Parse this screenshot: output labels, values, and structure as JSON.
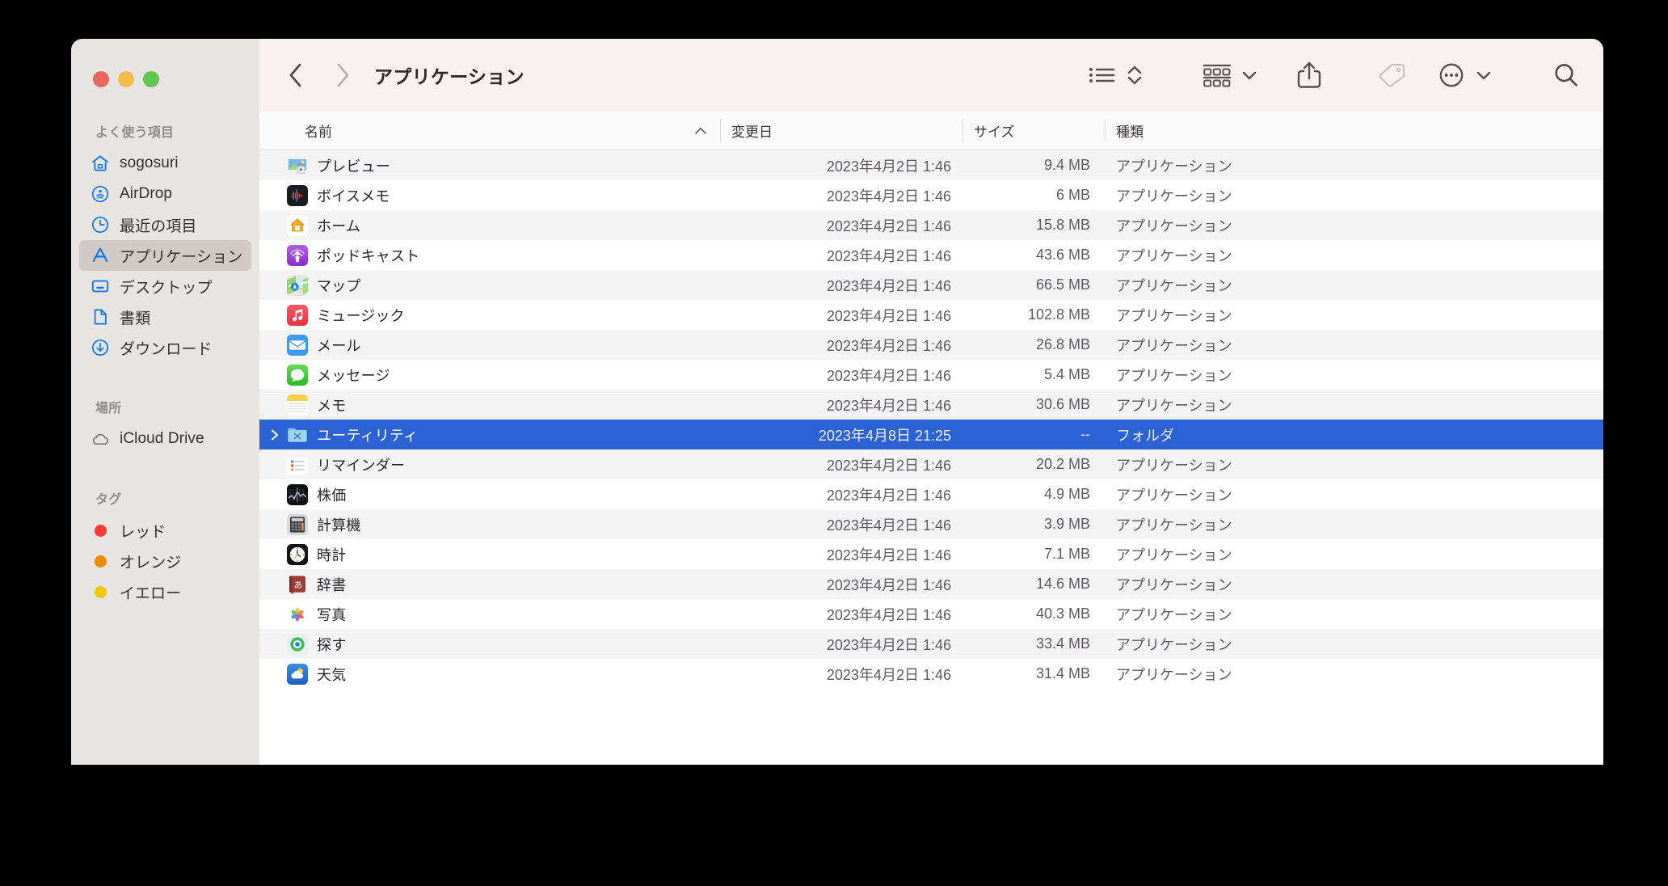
{
  "window": {
    "title": "アプリケーション",
    "traffic_lights": [
      {
        "name": "close",
        "color": "#e8685d"
      },
      {
        "name": "minimize",
        "color": "#f3bd4e"
      },
      {
        "name": "maximize",
        "color": "#61c554"
      }
    ]
  },
  "toolbar": {
    "back_label": "戻る",
    "forward_label": "進む",
    "view_list_label": "リスト表示",
    "view_arrange_label": "表示順",
    "group_label": "グループ",
    "share_label": "共有",
    "tag_label": "タグ",
    "more_label": "その他",
    "search_label": "検索"
  },
  "sidebar": {
    "sections": [
      {
        "title": "よく使う項目",
        "items": [
          {
            "label": "sogosuri",
            "icon": "home-icon",
            "selected": false
          },
          {
            "label": "AirDrop",
            "icon": "airdrop-icon",
            "selected": false
          },
          {
            "label": "最近の項目",
            "icon": "clock-icon",
            "selected": false
          },
          {
            "label": "アプリケーション",
            "icon": "applications-icon",
            "selected": true
          },
          {
            "label": "デスクトップ",
            "icon": "desktop-icon",
            "selected": false
          },
          {
            "label": "書類",
            "icon": "document-icon",
            "selected": false
          },
          {
            "label": "ダウンロード",
            "icon": "download-icon",
            "selected": false
          }
        ]
      },
      {
        "title": "場所",
        "items": [
          {
            "label": "iCloud Drive",
            "icon": "cloud-icon",
            "selected": false
          }
        ]
      },
      {
        "title": "タグ",
        "items": [
          {
            "label": "レッド",
            "icon": "tag-dot-icon",
            "color": "#fa3c35",
            "selected": false
          },
          {
            "label": "オレンジ",
            "icon": "tag-dot-icon",
            "color": "#ef8c06",
            "selected": false
          },
          {
            "label": "イエロー",
            "icon": "tag-dot-icon",
            "color": "#f3c70b",
            "selected": false
          }
        ]
      }
    ]
  },
  "columns": [
    {
      "label": "名前",
      "key": "name",
      "sorted": true,
      "sort_dir": "asc"
    },
    {
      "label": "変更日",
      "key": "date",
      "sorted": false,
      "sort_dir": ""
    },
    {
      "label": "サイズ",
      "key": "size",
      "sorted": false,
      "sort_dir": ""
    },
    {
      "label": "種類",
      "key": "kind",
      "sorted": false,
      "sort_dir": ""
    }
  ],
  "files": [
    {
      "name": "プレビュー",
      "icon": "preview-app-icon",
      "date": "2023年4月2日 1:46",
      "size": "9.4 MB",
      "kind": "アプリケーション",
      "selected": false,
      "expandable": false
    },
    {
      "name": "ボイスメモ",
      "icon": "voicememos-app-icon",
      "date": "2023年4月2日 1:46",
      "size": "6 MB",
      "kind": "アプリケーション",
      "selected": false,
      "expandable": false
    },
    {
      "name": "ホーム",
      "icon": "home-app-icon",
      "date": "2023年4月2日 1:46",
      "size": "15.8 MB",
      "kind": "アプリケーション",
      "selected": false,
      "expandable": false
    },
    {
      "name": "ポッドキャスト",
      "icon": "podcasts-app-icon",
      "date": "2023年4月2日 1:46",
      "size": "43.6 MB",
      "kind": "アプリケーション",
      "selected": false,
      "expandable": false
    },
    {
      "name": "マップ",
      "icon": "maps-app-icon",
      "date": "2023年4月2日 1:46",
      "size": "66.5 MB",
      "kind": "アプリケーション",
      "selected": false,
      "expandable": false
    },
    {
      "name": "ミュージック",
      "icon": "music-app-icon",
      "date": "2023年4月2日 1:46",
      "size": "102.8 MB",
      "kind": "アプリケーション",
      "selected": false,
      "expandable": false
    },
    {
      "name": "メール",
      "icon": "mail-app-icon",
      "date": "2023年4月2日 1:46",
      "size": "26.8 MB",
      "kind": "アプリケーション",
      "selected": false,
      "expandable": false
    },
    {
      "name": "メッセージ",
      "icon": "messages-app-icon",
      "date": "2023年4月2日 1:46",
      "size": "5.4 MB",
      "kind": "アプリケーション",
      "selected": false,
      "expandable": false
    },
    {
      "name": "メモ",
      "icon": "notes-app-icon",
      "date": "2023年4月2日 1:46",
      "size": "30.6 MB",
      "kind": "アプリケーション",
      "selected": false,
      "expandable": false
    },
    {
      "name": "ユーティリティ",
      "icon": "utilities-folder-icon",
      "date": "2023年4月8日 21:25",
      "size": "--",
      "kind": "フォルダ",
      "selected": true,
      "expandable": true
    },
    {
      "name": "リマインダー",
      "icon": "reminders-app-icon",
      "date": "2023年4月2日 1:46",
      "size": "20.2 MB",
      "kind": "アプリケーション",
      "selected": false,
      "expandable": false
    },
    {
      "name": "株価",
      "icon": "stocks-app-icon",
      "date": "2023年4月2日 1:46",
      "size": "4.9 MB",
      "kind": "アプリケーション",
      "selected": false,
      "expandable": false
    },
    {
      "name": "計算機",
      "icon": "calculator-app-icon",
      "date": "2023年4月2日 1:46",
      "size": "3.9 MB",
      "kind": "アプリケーション",
      "selected": false,
      "expandable": false
    },
    {
      "name": "時計",
      "icon": "clock-app-icon",
      "date": "2023年4月2日 1:46",
      "size": "7.1 MB",
      "kind": "アプリケーション",
      "selected": false,
      "expandable": false
    },
    {
      "name": "辞書",
      "icon": "dictionary-app-icon",
      "date": "2023年4月2日 1:46",
      "size": "14.6 MB",
      "kind": "アプリケーション",
      "selected": false,
      "expandable": false
    },
    {
      "name": "写真",
      "icon": "photos-app-icon",
      "date": "2023年4月2日 1:46",
      "size": "40.3 MB",
      "kind": "アプリケーション",
      "selected": false,
      "expandable": false
    },
    {
      "name": "探す",
      "icon": "findmy-app-icon",
      "date": "2023年4月2日 1:46",
      "size": "33.4 MB",
      "kind": "アプリケーション",
      "selected": false,
      "expandable": false
    },
    {
      "name": "天気",
      "icon": "weather-app-icon",
      "date": "2023年4月2日 1:46",
      "size": "31.4 MB",
      "kind": "アプリケーション",
      "selected": false,
      "expandable": false
    }
  ],
  "colors": {
    "selection_blue": "#2d62d4",
    "sidebar_bg": "#e8e4e1",
    "toolbar_bg": "#f7f2ef",
    "accent_blue": "#1177f0"
  }
}
